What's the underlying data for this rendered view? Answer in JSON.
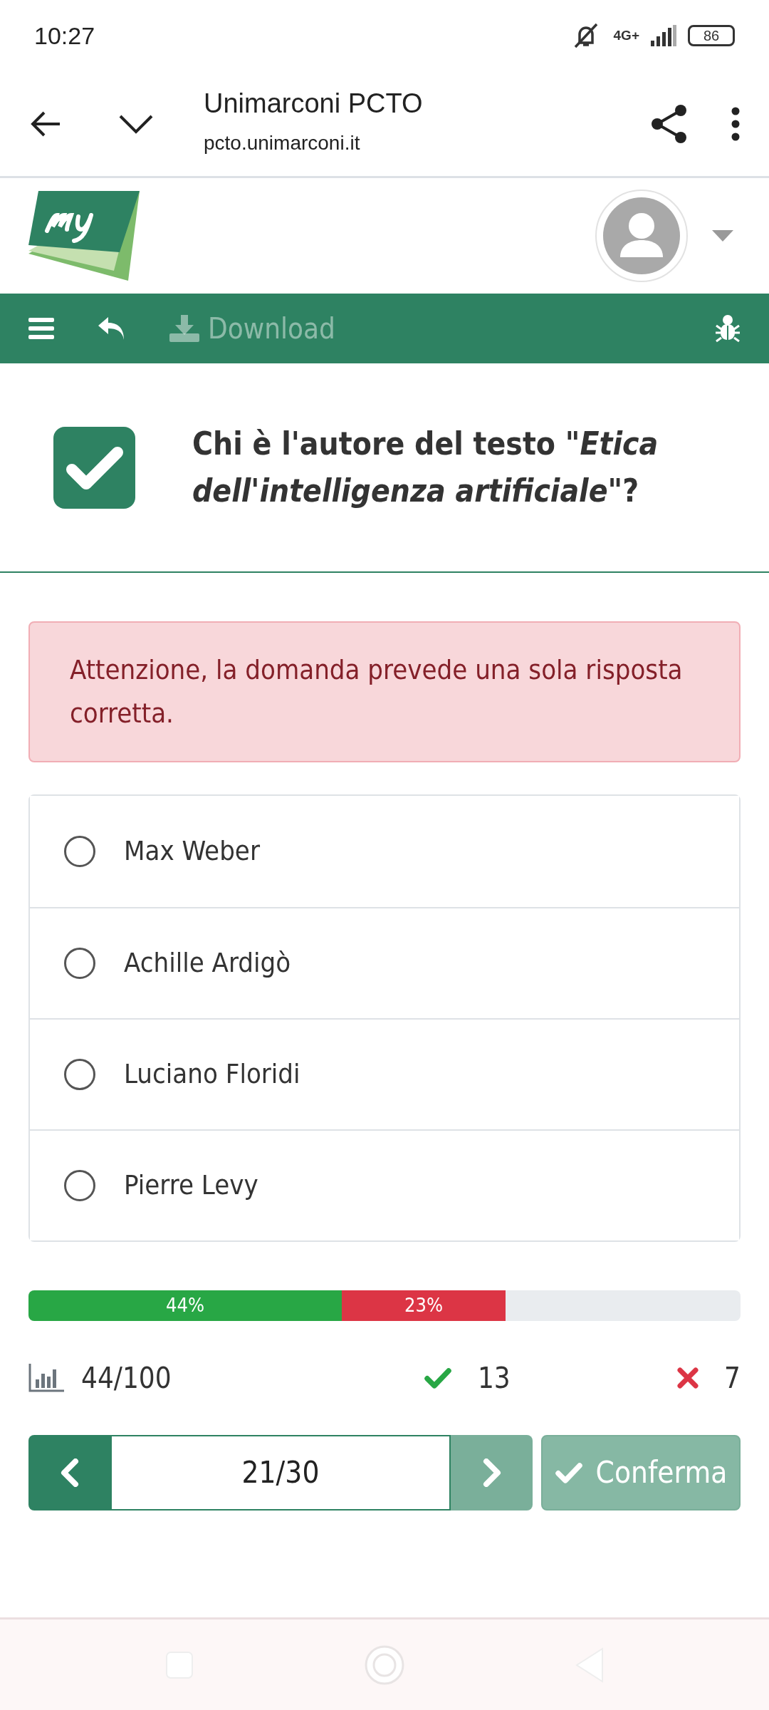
{
  "status_bar": {
    "time": "10:27",
    "network": "4G+",
    "battery": "86"
  },
  "browser": {
    "title": "Unimarconi PCTO",
    "url": "pcto.unimarconi.it"
  },
  "toolbar": {
    "download_label": "Download",
    "download_disabled": true
  },
  "question": {
    "text": "Chi è l'autore del testo \"*Etica dell'intelligenza artificiale*\"?"
  },
  "alert": {
    "text": "Attenzione, la domanda prevede una sola risposta corretta."
  },
  "options": [
    {
      "label": "Max Weber",
      "selected": false
    },
    {
      "label": "Achille Ardigò",
      "selected": false
    },
    {
      "label": "Luciano Floridi",
      "selected": false
    },
    {
      "label": "Pierre Levy",
      "selected": false
    }
  ],
  "progress": [
    {
      "kind": "correct",
      "label": "44%",
      "level": 0.44
    },
    {
      "kind": "wrong",
      "label": "23%"
    }
  ],
  "stats": {
    "score": "44/100",
    "correct": "13",
    "wrong": "7"
  },
  "pager": {
    "prev_disabled": false,
    "current": "21/30",
    "next_disabled": true,
    "confirm_label": "Conferma",
    "confirm_disabled": true
  }
}
